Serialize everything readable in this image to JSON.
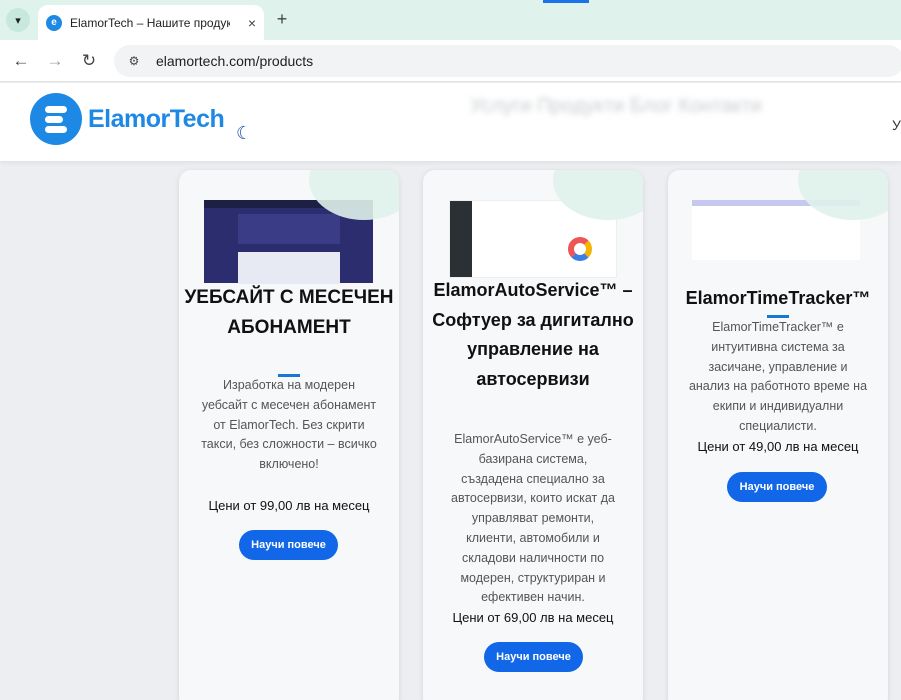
{
  "browser": {
    "tab_title": "ElamorTech – Нашите продукти",
    "tab_close": "×",
    "new_tab": "+",
    "url": "elamortech.com/products"
  },
  "header": {
    "logo_text": "ElamorTech",
    "theme_toggle_icon": "moon-icon",
    "blurred_menu": "Услуги  Продукти  Блог  Контакти",
    "cut_text": "У"
  },
  "cards": [
    {
      "title": "УЕБСАЙТ С МЕСЕЧЕН АБОНАМЕНТ",
      "description": "Изработка на модерен уебсайт с месечен абонамент от ElamorTech. Без скрити такси, без сложности – всичко включено!",
      "price": "Цени от 99,00 лв на месец",
      "button": "Научи повече"
    },
    {
      "title": "ElamorAutoService™ – Софтуер за дигитално управление на автосервизи",
      "description": "ElamorAutoService™ е уеб-базирана система, създадена специално за автосервизи, които искат да управляват ремонти, клиенти, автомобили и складови наличности по модерен, структуриран и ефективен начин.",
      "price": "Цени от 69,00 лв на месец",
      "button": "Научи повече"
    },
    {
      "title": "ElamorTimeTracker™",
      "description": "ElamorTimeTracker™ е интуитивна система за засичане, управление и анализ на работното време на екипи и индивидуални специалисти.",
      "price": "Цени от 49,00 лв на месец",
      "button": "Научи повече"
    }
  ],
  "colors": {
    "accent": "#1167e8",
    "brand": "#1e88e5",
    "tab_bar": "#dff3ec"
  }
}
